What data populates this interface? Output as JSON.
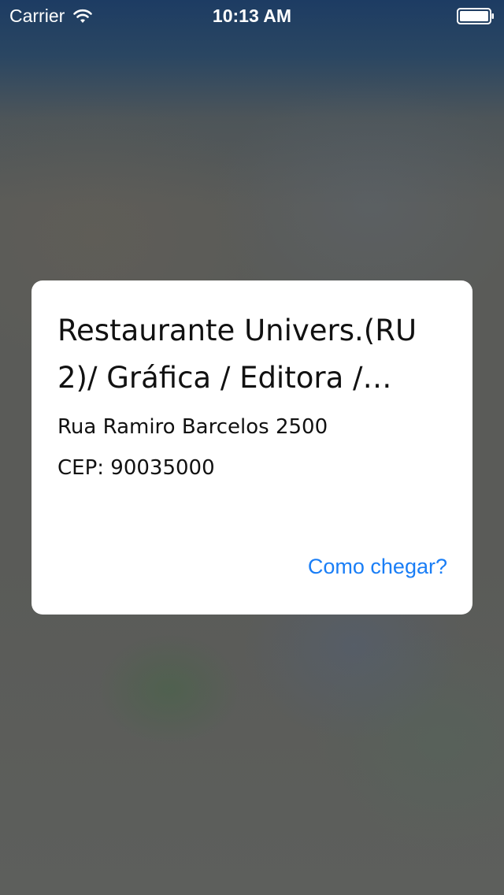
{
  "status_bar": {
    "carrier": "Carrier",
    "time": "10:13 AM",
    "wifi_icon": "wifi-icon",
    "battery_icon": "battery-icon"
  },
  "dialog": {
    "title_line1": "Restaurante Univers.(RU",
    "title_line2": "2)/ Gráfica / Editora /…",
    "address": "Rua Ramiro Barcelos 2500",
    "cep": "CEP: 90035000",
    "directions_label": "Como chegar?"
  },
  "colors": {
    "accent": "#1a7ef6",
    "dialog_background": "#ffffff",
    "status_bar_top": "#1d3c63"
  }
}
